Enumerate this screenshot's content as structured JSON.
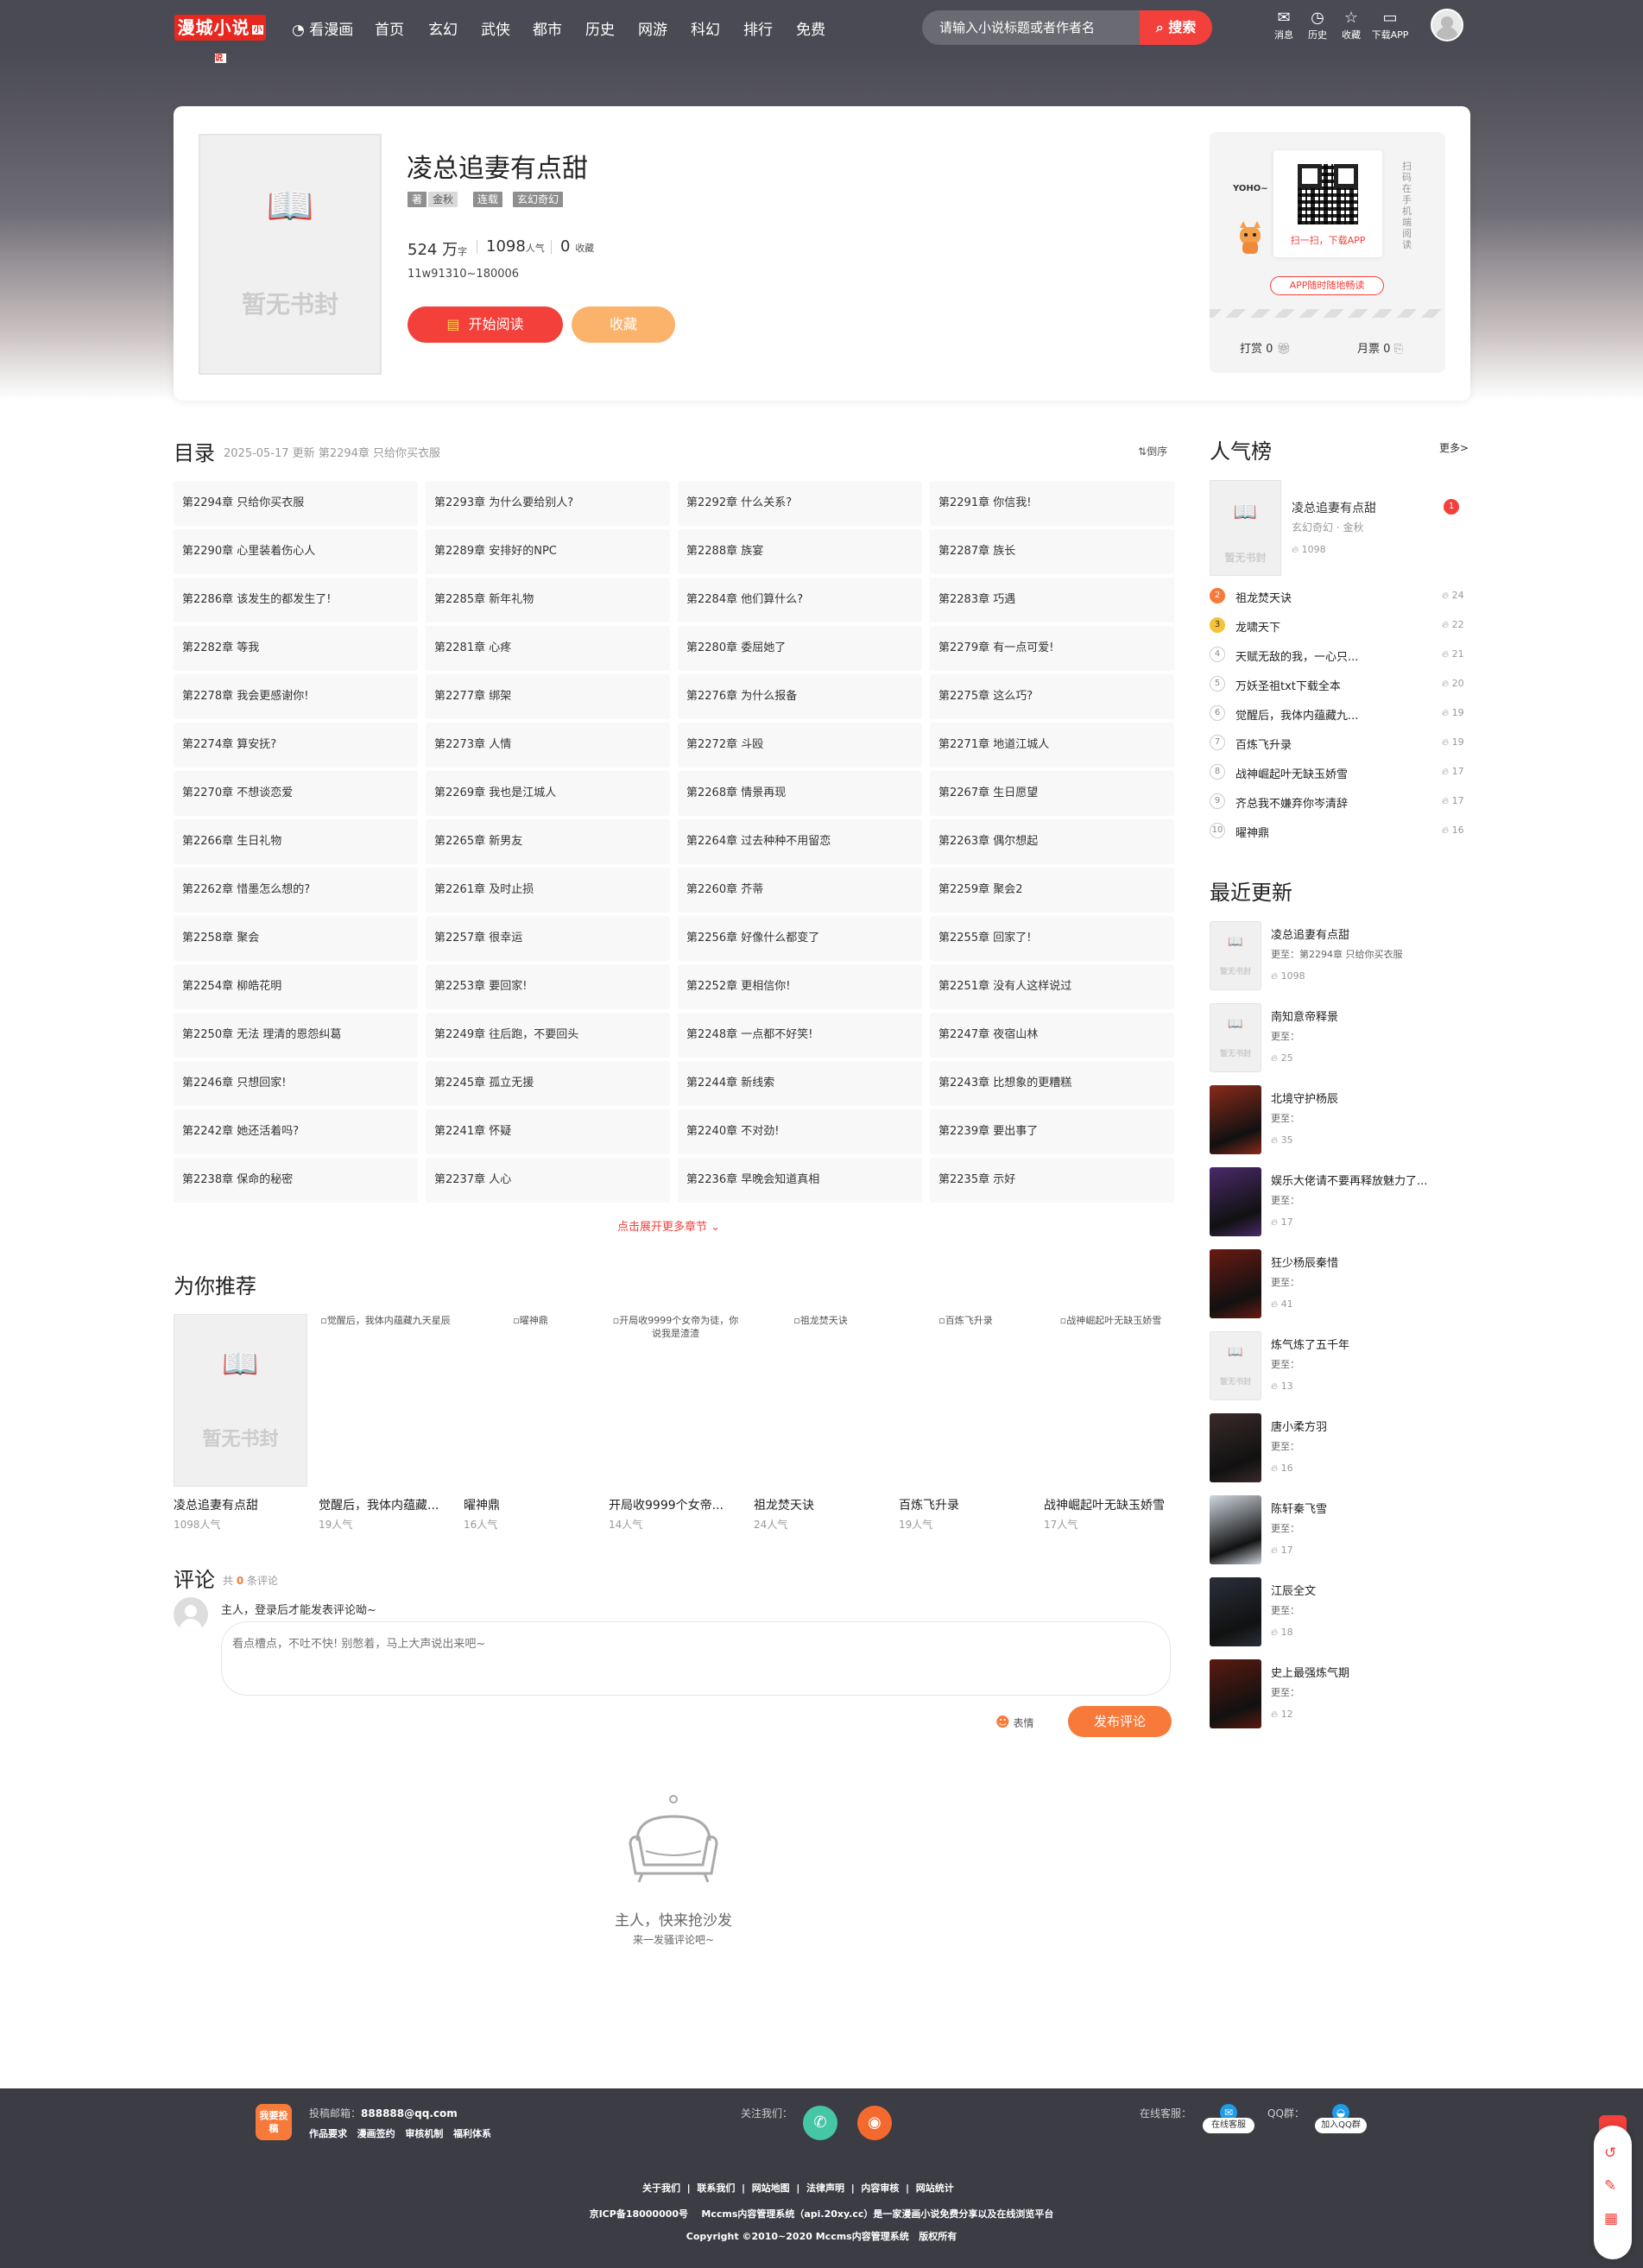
{
  "header": {
    "logo": "漫城小说",
    "logo_badge": "小说",
    "nav": [
      "看漫画",
      "首页",
      "玄幻",
      "武侠",
      "都市",
      "历史",
      "网游",
      "科幻",
      "排行",
      "免费"
    ],
    "search_placeholder": "请输入小说标题或者作者名",
    "search_button": "搜索",
    "icons": [
      "消息",
      "历史",
      "收藏",
      "下载APP"
    ]
  },
  "book": {
    "title": "凌总追妻有点甜",
    "author_tag": "著",
    "author": "金秋",
    "status": "连载",
    "genre": "玄幻奇幻",
    "words": "524 万",
    "words_unit": "字",
    "popularity": "1098",
    "popularity_unit": "人气",
    "favorites": "0",
    "favorites_unit": "收藏",
    "id_line": "11w91310~180006",
    "read_button": "开始阅读",
    "fav_button": "收藏",
    "cover_text": "暂无书封"
  },
  "app_box": {
    "mascot_text": "YOHO~",
    "qr_caption": "扫一扫，下载APP",
    "vertical_text": "扫码在手机端阅读",
    "app_button": "APP随时随地畅读",
    "tip_label": "打赏",
    "tip_value": "0",
    "ticket_label": "月票",
    "ticket_value": "0"
  },
  "catalog": {
    "title": "目录",
    "updated": "2025-05-17 更新 第2294章 只给你买衣服",
    "sort": "倒序",
    "more": "点击展开更多章节",
    "chapters": [
      "第2294章 只给你买衣服",
      "第2293章 为什么要给别人?",
      "第2292章 什么关系?",
      "第2291章 你信我!",
      "第2290章 心里装着伤心人",
      "第2289章 安排好的NPC",
      "第2288章 族宴",
      "第2287章 族长",
      "第2286章 该发生的都发生了!",
      "第2285章 新年礼物",
      "第2284章 他们算什么?",
      "第2283章 巧遇",
      "第2282章 等我",
      "第2281章 心疼",
      "第2280章 委屈她了",
      "第2279章 有一点可爱!",
      "第2278章 我会更感谢你!",
      "第2277章 绑架",
      "第2276章 为什么报备",
      "第2275章 这么巧?",
      "第2274章 算安抚?",
      "第2273章 人情",
      "第2272章 斗殴",
      "第2271章 地道江城人",
      "第2270章 不想谈恋爱",
      "第2269章 我也是江城人",
      "第2268章 情景再现",
      "第2267章 生日愿望",
      "第2266章 生日礼物",
      "第2265章 新男友",
      "第2264章 过去种种不用留恋",
      "第2263章 偶尔想起",
      "第2262章 惜墨怎么想的?",
      "第2261章 及时止损",
      "第2260章 芥蒂",
      "第2259章 聚会2",
      "第2258章 聚会",
      "第2257章 很幸运",
      "第2256章 好像什么都变了",
      "第2255章 回家了!",
      "第2254章 柳皓花明",
      "第2253章 要回家!",
      "第2252章 更相信你!",
      "第2251章 没有人这样说过",
      "第2250章 无法 理清的恩怨纠葛",
      "第2249章 往后跑，不要回头",
      "第2248章 一点都不好笑!",
      "第2247章 夜宿山林",
      "第2246章 只想回家!",
      "第2245章 孤立无援",
      "第2244章 新线索",
      "第2243章 比想象的更糟糕",
      "第2242章 她还活着吗?",
      "第2241章 怀疑",
      "第2240章 不对劲!",
      "第2239章 要出事了",
      "第2238章 保命的秘密",
      "第2237章 人心",
      "第2236章 早晚会知道真相",
      "第2235章 示好"
    ]
  },
  "recommend": {
    "title": "为你推荐",
    "items": [
      {
        "title": "凌总追妻有点甜",
        "hot": "1098人气",
        "alt": ""
      },
      {
        "title": "觉醒后，我体内蕴藏...",
        "hot": "19人气",
        "alt": "觉醒后，我体内蕴藏九天星辰"
      },
      {
        "title": "曜神鼎",
        "hot": "16人气",
        "alt": "曜神鼎"
      },
      {
        "title": "开局收9999个女帝...",
        "hot": "14人气",
        "alt": "开局收9999个女帝为徒，你说我是渣渣"
      },
      {
        "title": "祖龙焚天诀",
        "hot": "24人气",
        "alt": "祖龙焚天诀"
      },
      {
        "title": "百炼飞升录",
        "hot": "19人气",
        "alt": "百炼飞升录"
      },
      {
        "title": "战神崛起叶无缺玉娇雪",
        "hot": "17人气",
        "alt": "战神崛起叶无缺玉娇雪"
      }
    ]
  },
  "comments": {
    "title": "评论",
    "count_prefix": "共",
    "count": "0",
    "count_suffix": "条评论",
    "login_hint": "主人，登录后才能发表评论呦~",
    "placeholder": "看点槽点，不吐不快! 别憋着，马上大声说出来吧~",
    "emoji": "表情",
    "submit": "发布评论",
    "empty_title": "主人，快来抢沙发",
    "empty_sub": "来一发骚评论吧~"
  },
  "ranking": {
    "title": "人气榜",
    "more": "更多>",
    "top": {
      "title": "凌总追妻有点甜",
      "meta": "玄幻奇幻 · 金秋",
      "hot": "1098",
      "rank": "1"
    },
    "list": [
      {
        "rank": "2",
        "title": "祖龙焚天诀",
        "hot": "24"
      },
      {
        "rank": "3",
        "title": "龙啸天下",
        "hot": "22"
      },
      {
        "rank": "4",
        "title": "天赋无敌的我，一心只...",
        "hot": "21"
      },
      {
        "rank": "5",
        "title": "万妖圣祖txt下载全本",
        "hot": "20"
      },
      {
        "rank": "6",
        "title": "觉醒后，我体内蕴藏九...",
        "hot": "19"
      },
      {
        "rank": "7",
        "title": "百炼飞升录",
        "hot": "19"
      },
      {
        "rank": "8",
        "title": "战神崛起叶无缺玉娇雪",
        "hot": "17"
      },
      {
        "rank": "9",
        "title": "齐总我不嫌弃你岑清辞",
        "hot": "17"
      },
      {
        "rank": "10",
        "title": "曜神鼎",
        "hot": "16"
      }
    ]
  },
  "updates": {
    "title": "最近更新",
    "items": [
      {
        "title": "凌总追妻有点甜",
        "line": "更至：第2294章 只给你买衣服",
        "hot": "1098"
      },
      {
        "title": "南知意帝释景",
        "line": "更至：",
        "hot": "25"
      },
      {
        "title": "北境守护杨辰",
        "line": "更至：",
        "hot": "35"
      },
      {
        "title": "娱乐大佬请不要再释放魅力了...",
        "line": "更至：",
        "hot": "17"
      },
      {
        "title": "狂少杨辰秦惜",
        "line": "更至：",
        "hot": "41"
      },
      {
        "title": "炼气炼了五千年",
        "line": "更至：",
        "hot": "13"
      },
      {
        "title": "唐小柔方羽",
        "line": "更至：",
        "hot": "16"
      },
      {
        "title": "陈轩秦飞雪",
        "line": "更至：",
        "hot": "17"
      },
      {
        "title": "江辰全文",
        "line": "更至：",
        "hot": "18"
      },
      {
        "title": "史上最强炼气期",
        "line": "更至：",
        "hot": "12"
      }
    ]
  },
  "footer": {
    "badge": "我要投稿",
    "email_label": "投稿邮箱：",
    "email": "888888@qq.com",
    "links1": [
      "作品要求",
      "漫画签约",
      "审核机制",
      "福利体系"
    ],
    "follow": "关注我们：",
    "service": "在线客服：",
    "service_btn": "在线客服",
    "qq": "QQ群：",
    "qq_btn": "加入QQ群",
    "links2": [
      "关于我们",
      "联系我们",
      "网站地图",
      "法律声明",
      "内容审核",
      "网站统计"
    ],
    "icp": "京ICP备18000000号    Mccms内容管理系统（api.20xy.cc）是一家漫画小说免费分享以及在线浏览平台",
    "copyright": "Copyright ©2010~2020 Mccms内容管理系统   版权所有"
  },
  "colors": {
    "accent": "#f3403a",
    "orange": "#fbb36c",
    "header": "#4a4a54",
    "footer": "#3c3c44"
  }
}
